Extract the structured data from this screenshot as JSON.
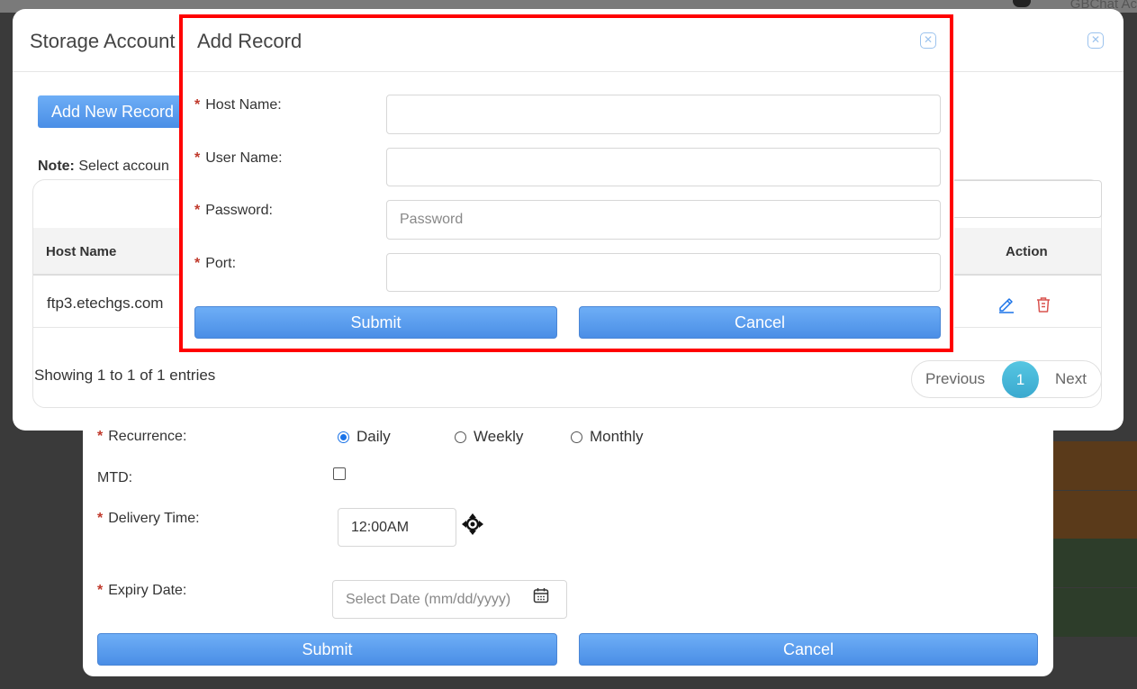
{
  "background": {
    "top_right_text": "GBChat Ac"
  },
  "storage_modal": {
    "title": "Storage Account",
    "add_new_label": "Add New Record",
    "note_label": "Note:",
    "note_text": "Select accoun",
    "table": {
      "headers": [
        "Host Name",
        "Action"
      ],
      "rows": [
        {
          "host_name": "ftp3.etechgs.com"
        }
      ]
    },
    "showing_text": "Showing 1 to 1 of 1 entries",
    "pagination": {
      "previous": "Previous",
      "current": "1",
      "next": "Next"
    }
  },
  "add_record_modal": {
    "title": "Add Record",
    "fields": {
      "host_name": {
        "label": "Host Name:",
        "value": ""
      },
      "user_name": {
        "label": "User Name:",
        "value": ""
      },
      "password": {
        "label": "Password:",
        "placeholder": "Password"
      },
      "port": {
        "label": "Port:",
        "value": ""
      }
    },
    "submit_label": "Submit",
    "cancel_label": "Cancel"
  },
  "form_modal": {
    "recurrence": {
      "label": "Recurrence:",
      "options": [
        "Daily",
        "Weekly",
        "Monthly"
      ],
      "selected": "Daily"
    },
    "mtd_label": "MTD:",
    "delivery_time": {
      "label": "Delivery Time:",
      "value": "12:00AM"
    },
    "expiry_date": {
      "label": "Expiry Date:",
      "placeholder": "Select Date (mm/dd/yyyy)"
    },
    "submit_label": "Submit",
    "cancel_label": "Cancel"
  },
  "colors": {
    "primary": "#4a8ee6",
    "highlight": "#ff0000",
    "pager_active": "#3aa9cf",
    "delete_icon": "#d9534f",
    "edit_icon": "#1a73e8"
  },
  "icons": [
    "close-icon",
    "edit-icon",
    "delete-icon",
    "move-icon",
    "calendar-icon"
  ]
}
